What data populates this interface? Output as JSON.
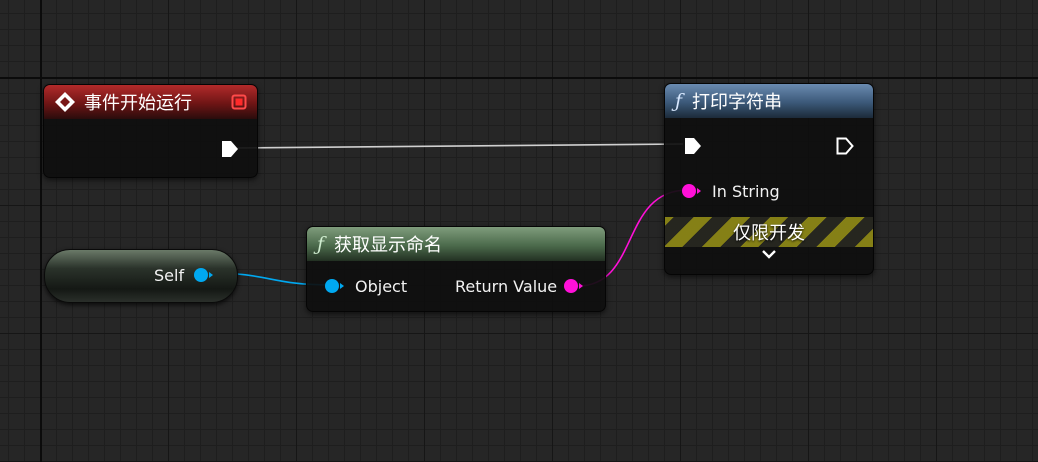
{
  "nodes": {
    "event_begin_play": {
      "title": "事件开始运行"
    },
    "print_string": {
      "title": "打印字符串",
      "in_string_label": "In String",
      "dev_only_label": "仅限开发"
    },
    "get_display_name": {
      "title": "获取显示命名",
      "object_label": "Object",
      "return_label": "Return Value"
    },
    "self_node": {
      "label": "Self"
    }
  },
  "colors": {
    "exec_wire": "#d0d0d0",
    "object_pin": "#00a8f0",
    "string_pin": "#ff10d8",
    "event_header": "#a01e1e",
    "function_header_blue": "#5479a0",
    "pure_function_header_green": "#62815f"
  },
  "icons": [
    "diamond-event-icon",
    "red-stop-icon",
    "function-icon",
    "exec-pin-icon",
    "chevron-down-icon"
  ]
}
